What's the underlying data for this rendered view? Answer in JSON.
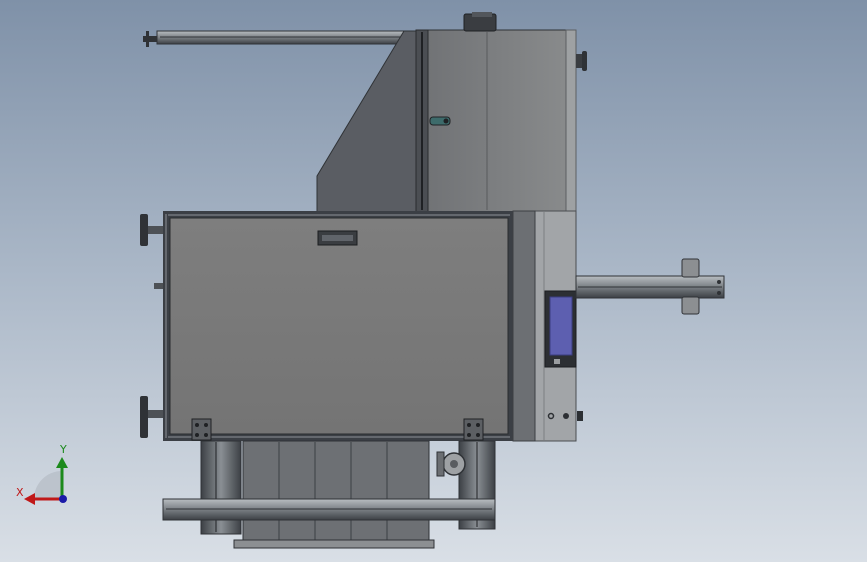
{
  "triad": {
    "x_label": "X",
    "y_label": "Y",
    "x_color": "#c01818",
    "y_color": "#1c8a1c",
    "z_color": "#1a1aa8"
  },
  "view": {
    "background_top": "#7f91a8",
    "background_bottom": "#d9dfe6",
    "model_color": "#7b7b7b",
    "screen_color": "#5d5fb0",
    "frame_dark": "#3b3f45"
  }
}
